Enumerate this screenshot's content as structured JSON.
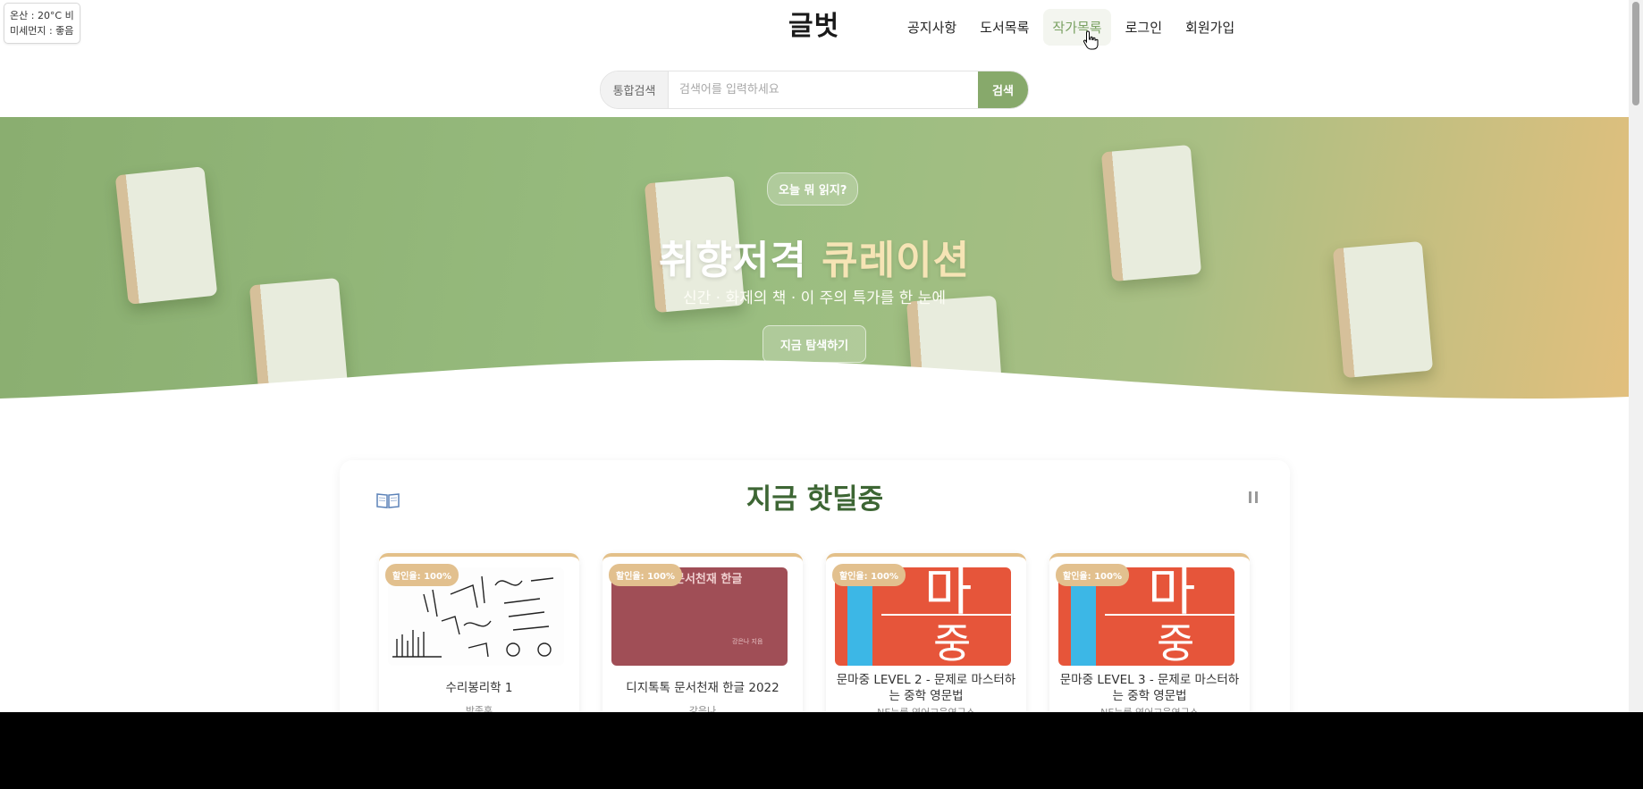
{
  "weather": {
    "line1": "온산 : 20°C 비",
    "line2": "미세먼지 : 좋음"
  },
  "header": {
    "logo": "글벗",
    "nav": [
      "공지사항",
      "도서목록",
      "작가목록",
      "로그인",
      "회원가입"
    ]
  },
  "search": {
    "label": "통합검색",
    "placeholder": "검색어를 입력하세요",
    "button": "검색"
  },
  "hero": {
    "pill": "오늘 뭐 읽지?",
    "title_main": "취향저격",
    "title_accent": "큐레이션",
    "subtitle": "신간 · 화제의 책 · 이 주의 특가를 한 눈에",
    "cta": "지금 탐색하기"
  },
  "deals": {
    "title": "지금 핫딜중",
    "books": [
      {
        "badge": "할인율: 100%",
        "title": "수리봉리학 1",
        "author": "박종훈"
      },
      {
        "badge": "할인율: 100%",
        "title": "디지톡톡 문서천재 한글 2022",
        "author": "강은나",
        "cover_text": "문서천재 한글",
        "cover_author": "강은나 지음"
      },
      {
        "badge": "할인율: 100%",
        "title": "문마중 LEVEL 2 - 문제로 마스터하는 중학 영문법",
        "author": "NE능률 영어교육연구소",
        "cover_glyph_top": "마",
        "cover_glyph_bottom": "중"
      },
      {
        "badge": "할인율: 100%",
        "title": "문마중 LEVEL 3 - 문제로 마스터하는 중학 영문법",
        "author": "NE능률 영어교육연구소",
        "cover_glyph_top": "마",
        "cover_glyph_bottom": "중"
      }
    ]
  },
  "colors": {
    "accent": "#87a96b",
    "title_green": "#3d6634",
    "badge": "#e2c08e"
  }
}
